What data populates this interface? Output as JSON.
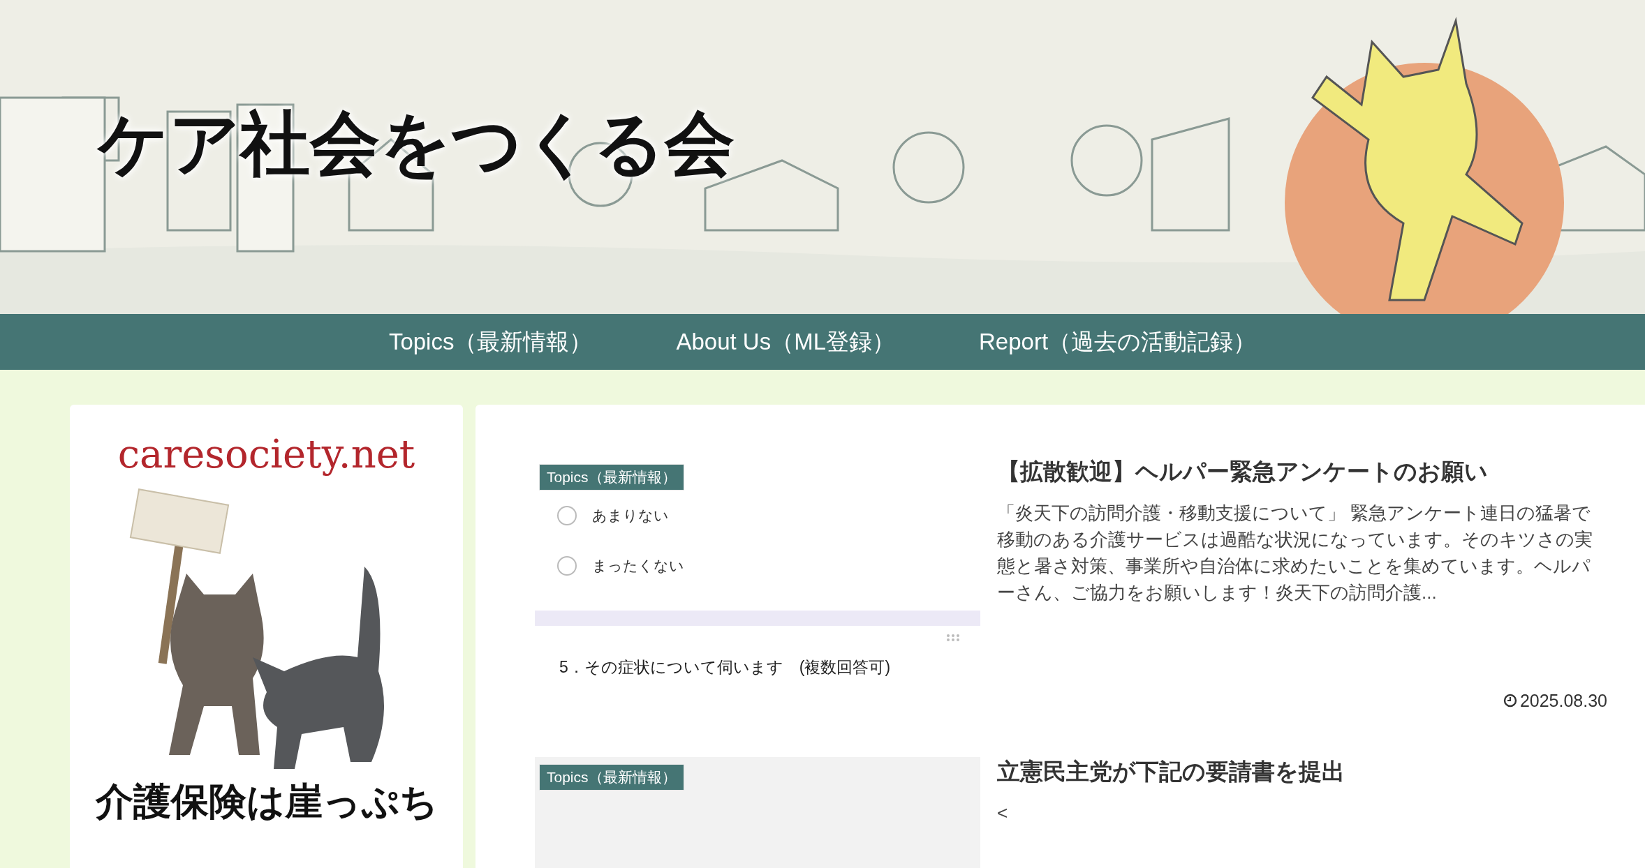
{
  "header": {
    "title": "ケア社会をつくる会"
  },
  "nav": [
    {
      "label": "Topics（最新情報）"
    },
    {
      "label": "About Us（ML登録）"
    },
    {
      "label": "Report（過去の活動記録）"
    }
  ],
  "sidebar": {
    "site_name": "caresociety.net",
    "banner_caption": "介護保険は崖っぷち"
  },
  "posts": [
    {
      "category": "Topics（最新情報）",
      "title": "【拡散歓迎】ヘルパー緊急アンケートのお願い",
      "excerpt": "「炎天下の訪問介護・移動支援について」 緊急アンケート連日の猛暑で移動のある介護サービスは過酷な状況になっています。そのキツさの実態と暑さ対策、事業所や自治体に求めたいことを集めています。ヘルパーさん、ご協力をお願いします！炎天下の訪問介護...",
      "date": "2025.08.30",
      "thumbnail": {
        "kind": "form",
        "options": [
          {
            "kind": "radio",
            "label": "あまりない"
          },
          {
            "kind": "radio",
            "label": "まったくない"
          }
        ],
        "question": "5．その症状について伺います　(複数回答可)"
      }
    },
    {
      "category": "Topics（最新情報）",
      "title": "立憲民主党が下記の要請書を提出",
      "excerpt": "<",
      "thumbnail": {
        "kind": "blank"
      }
    }
  ]
}
